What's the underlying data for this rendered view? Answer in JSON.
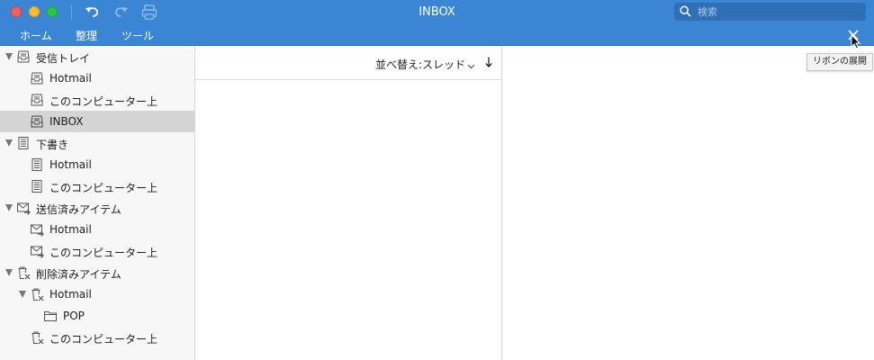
{
  "window": {
    "title": "INBOX",
    "search_placeholder": "検索"
  },
  "ribbon": {
    "tabs": [
      {
        "label": "ホーム"
      },
      {
        "label": "整理"
      },
      {
        "label": "ツール"
      }
    ],
    "tooltip": "リボンの展開"
  },
  "sidebar": {
    "items": [
      {
        "label": "受信トレイ",
        "icon": "inbox-icon",
        "expanded": true
      },
      {
        "label": "Hotmail",
        "icon": "inbox-icon"
      },
      {
        "label": "このコンピューター上",
        "icon": "inbox-icon"
      },
      {
        "label": "INBOX",
        "icon": "inbox-icon",
        "selected": true
      },
      {
        "label": "下書き",
        "icon": "drafts-icon",
        "expanded": true
      },
      {
        "label": "Hotmail",
        "icon": "drafts-icon"
      },
      {
        "label": "このコンピューター上",
        "icon": "drafts-icon"
      },
      {
        "label": "送信済みアイテム",
        "icon": "sent-icon",
        "expanded": true
      },
      {
        "label": "Hotmail",
        "icon": "sent-icon"
      },
      {
        "label": "このコンピューター上",
        "icon": "sent-icon"
      },
      {
        "label": "削除済みアイテム",
        "icon": "trash-icon",
        "expanded": true
      },
      {
        "label": "Hotmail",
        "icon": "trash-icon",
        "expanded": true
      },
      {
        "label": "POP",
        "icon": "folder-icon"
      },
      {
        "label": "このコンピューター上",
        "icon": "trash-icon"
      }
    ]
  },
  "messagelist": {
    "sort_label": "並べ替え:スレッド"
  },
  "colors": {
    "titlebar": "#3a86d4",
    "selection": "#d4d4d4",
    "sidebar": "#f7f7f7"
  }
}
